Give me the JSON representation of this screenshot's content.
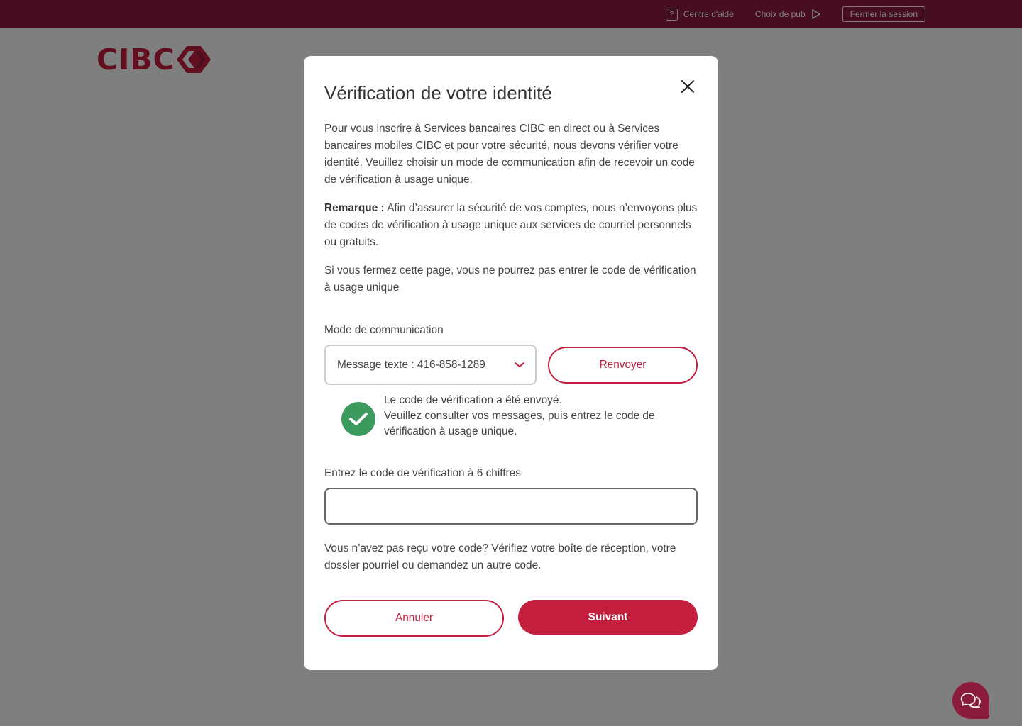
{
  "topbar": {
    "help_label": "Centre d'aide",
    "ads_label": "Choix de pub",
    "logout_label": "Fermer la session"
  },
  "logo": {
    "text": "CIBC"
  },
  "modal": {
    "title": "Vérification de votre identité",
    "intro": "Pour vous inscrire à Services bancaires CIBC en direct ou à Services bancaires mobiles CIBC et pour votre sécurité, nous devons vérifier votre identité. Veuillez choisir un mode de communication afin de recevoir un code de vérification à usage unique.",
    "note_label": "Remarque :",
    "note_text": " Afin d’assurer la sécurité de vos comptes, nous n’envoyons plus de codes de vérification à usage unique aux services de courriel personnels ou gratuits.",
    "warning": "Si vous fermez cette page, vous ne pourrez pas entrer le code de vérification à usage unique",
    "mode_label": "Mode de communication",
    "mode_value": "Message texte : 416-858-1289",
    "resend_label": "Renvoyer",
    "success_line1": "Le code de vérification a été envoyé.",
    "success_line2": "Veuillez consulter vos messages, puis entrez le code de vérification à usage unique.",
    "code_label": "Entrez le code de vérification à 6 chiffres",
    "code_value": "",
    "help_text": "Vous n’avez pas reçu votre code? Vérifiez votre boîte de réception, votre dossier pourriel ou demandez un autre code.",
    "cancel_label": "Annuler",
    "next_label": "Suivant"
  },
  "colors": {
    "brand": "#8c1c3c",
    "accent": "#c41f3e",
    "success": "#3c9a5f"
  },
  "icons": [
    "help-icon",
    "ad-choices-icon",
    "close-icon",
    "chevron-down-icon",
    "checkmark-icon",
    "chat-icon"
  ]
}
